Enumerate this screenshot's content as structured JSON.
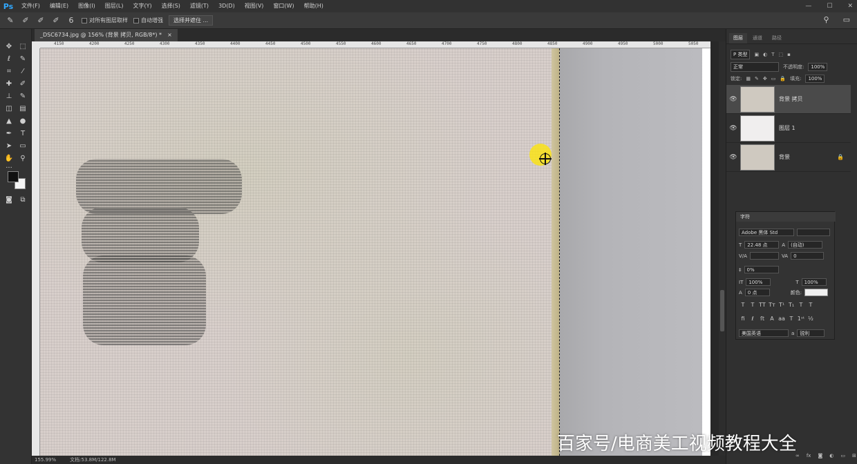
{
  "app": {
    "logo": "Ps"
  },
  "menu": [
    "文件(F)",
    "编辑(E)",
    "图像(I)",
    "图层(L)",
    "文字(Y)",
    "选择(S)",
    "滤镜(T)",
    "3D(D)",
    "视图(V)",
    "窗口(W)",
    "帮助(H)"
  ],
  "options": {
    "brush_size": "6",
    "sample_all_layers": "对所有图层取样",
    "auto_enhance": "自动增强",
    "select_mask_button": "选择并遮住 ..."
  },
  "document": {
    "tab_title": "_DSC6734.jpg @ 156% (背景 拷贝, RGB/8*) *",
    "zoom": "155.99%",
    "doc_size": "文档:53.8M/122.8M"
  },
  "ruler": [
    "4150",
    "4200",
    "4250",
    "4300",
    "4350",
    "4400",
    "4450",
    "4500",
    "4550",
    "4600",
    "4650",
    "4700",
    "4750",
    "4800",
    "4850",
    "4900",
    "4950",
    "5000",
    "5050"
  ],
  "layers_panel": {
    "tabs": [
      "图层",
      "通道",
      "路径"
    ],
    "filter": "P 类型",
    "blend_mode": "正常",
    "opacity_label": "不透明度:",
    "opacity": "100%",
    "lock_label": "锁定:",
    "fill_label": "填充:",
    "fill": "100%",
    "layers": [
      {
        "name": "背景 拷贝",
        "selected": true
      },
      {
        "name": "图层 1",
        "selected": false
      },
      {
        "name": "背景",
        "selected": false,
        "locked": true
      }
    ]
  },
  "character_panel": {
    "title": "字符",
    "font": "Adobe 黑体 Std",
    "size": "22.48 点",
    "leading": "(自动)",
    "tracking": "0",
    "vscale_percent": "0%",
    "vscale": "100%",
    "hscale": "100%",
    "baseline": "0 点",
    "color_label": "颜色:",
    "language": "美国英语",
    "antialias": "锐利"
  },
  "watermark": "百家号/电商美工视频教程大全"
}
